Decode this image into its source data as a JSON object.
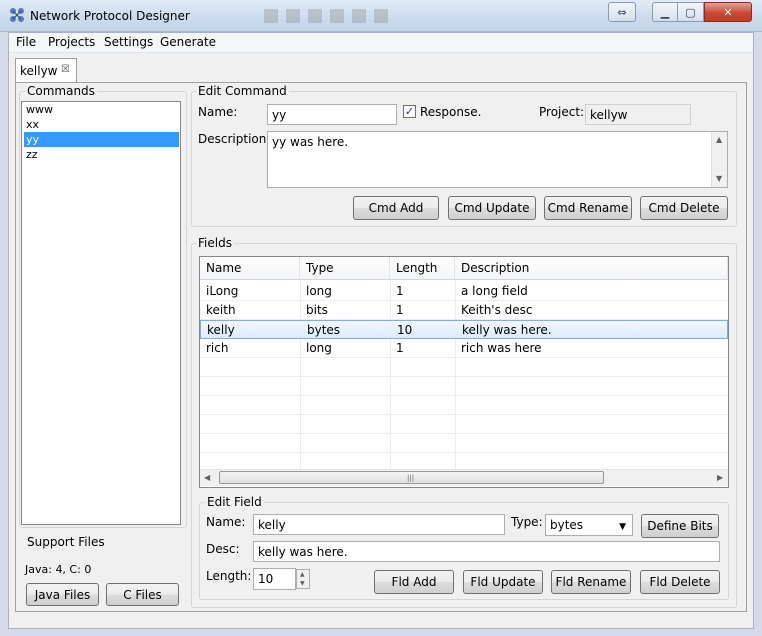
{
  "window": {
    "title": "Network Protocol Designer"
  },
  "menu": {
    "items": [
      "File",
      "Projects",
      "Settings",
      "Generate"
    ]
  },
  "tab": {
    "label": "kellyw"
  },
  "commands": {
    "label": "Commands",
    "items": [
      "www",
      "xx",
      "yy",
      "zz"
    ],
    "selected_index": 2
  },
  "support": {
    "label": "Support Files",
    "status": "Java: 4, C: 0",
    "java_button": "Java Files",
    "c_button": "C Files"
  },
  "edit_command": {
    "label": "Edit Command",
    "name_label": "Name:",
    "name_value": "yy",
    "response_label": "Response.",
    "response_checked": true,
    "project_label": "Project:",
    "project_value": "kellyw",
    "description_label": "Description:",
    "description_value": "yy was here.",
    "buttons": {
      "add": "Cmd Add",
      "update": "Cmd Update",
      "rename": "Cmd Rename",
      "delete": "Cmd Delete"
    }
  },
  "fields": {
    "label": "Fields",
    "columns": [
      "Name",
      "Type",
      "Length",
      "Description"
    ],
    "rows": [
      {
        "name": "iLong",
        "type": "long",
        "length": "1",
        "description": "a long field"
      },
      {
        "name": "keith",
        "type": "bits",
        "length": "1",
        "description": "Keith's desc"
      },
      {
        "name": "kelly",
        "type": "bytes",
        "length": "10",
        "description": "kelly was here."
      },
      {
        "name": "rich",
        "type": "long",
        "length": "1",
        "description": "rich was here"
      }
    ],
    "selected_index": 2
  },
  "edit_field": {
    "label": "Edit Field",
    "name_label": "Name:",
    "name_value": "kelly",
    "type_label": "Type:",
    "type_value": "bytes",
    "define_bits": "Define Bits",
    "desc_label": "Desc:",
    "desc_value": "kelly was here.",
    "length_label": "Length:",
    "length_value": "10",
    "buttons": {
      "add": "Fld Add",
      "update": "Fld Update",
      "rename": "Fld Rename",
      "delete": "Fld Delete"
    }
  },
  "colors": {
    "selection": "#3399ff",
    "row_selection_border": "#84acdd",
    "close_button": "#c94a35"
  }
}
